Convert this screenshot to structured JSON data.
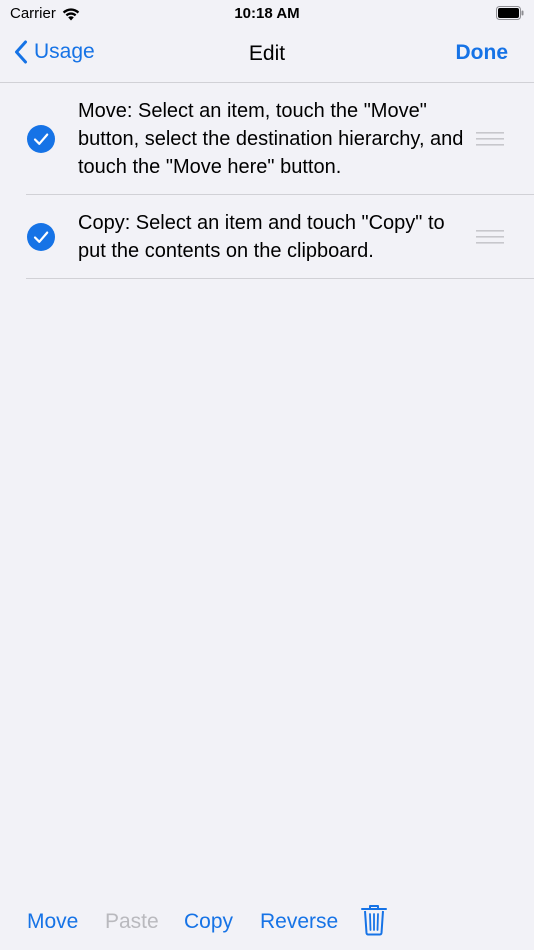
{
  "status": {
    "carrier": "Carrier",
    "time": "10:18 AM"
  },
  "nav": {
    "back_label": "Usage",
    "title": "Edit",
    "done_label": "Done"
  },
  "list": {
    "items": [
      {
        "text": "Move: Select an item, touch the \"Move\" button, select the destination hierarchy, and touch the \"Move here\" button.",
        "selected": true
      },
      {
        "text": "Copy: Select an item and touch \"Copy\" to put the contents on the clipboard.",
        "selected": true
      }
    ]
  },
  "toolbar": {
    "move_label": "Move",
    "paste_label": "Paste",
    "copy_label": "Copy",
    "reverse_label": "Reverse"
  },
  "colors": {
    "accent": "#1673e6",
    "disabled": "#b9b9be",
    "background": "#f2f2f7",
    "separator": "#d1d1d6"
  },
  "icons": {
    "back": "chevron-left-icon",
    "check": "checkmark-circle-icon",
    "reorder": "reorder-handle-icon",
    "trash": "trash-icon"
  }
}
